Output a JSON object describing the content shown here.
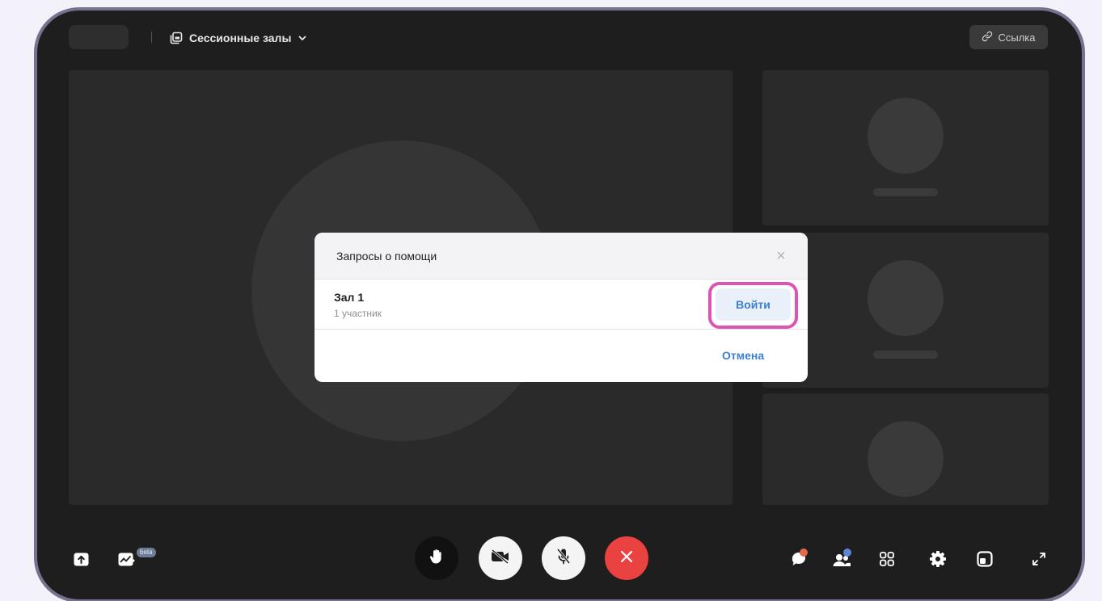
{
  "header": {
    "rooms_label": "Сессионные залы",
    "link_label": "Ссылка"
  },
  "modal": {
    "title": "Запросы о помощи",
    "close_label": "×",
    "room": {
      "name": "Зал 1",
      "participants": "1 участник",
      "join_label": "Войти"
    },
    "cancel_label": "Отмена"
  },
  "toolbar": {
    "beta_label": "beta",
    "left_icons": [
      "share-screen-icon",
      "whiteboard-icon"
    ],
    "center_controls": [
      "raise-hand-icon",
      "camera-off-icon",
      "mic-off-icon",
      "end-call-icon"
    ],
    "right_icons": [
      "chat-icon",
      "participants-icon",
      "apps-grid-icon",
      "settings-icon",
      "layout-icon",
      "fullscreen-icon"
    ]
  },
  "colors": {
    "frame_border": "#77708e",
    "background": "#1e1e1e",
    "accent": "#3d7fd0",
    "highlight": "#dc55b2",
    "end_call": "#ea4141"
  }
}
